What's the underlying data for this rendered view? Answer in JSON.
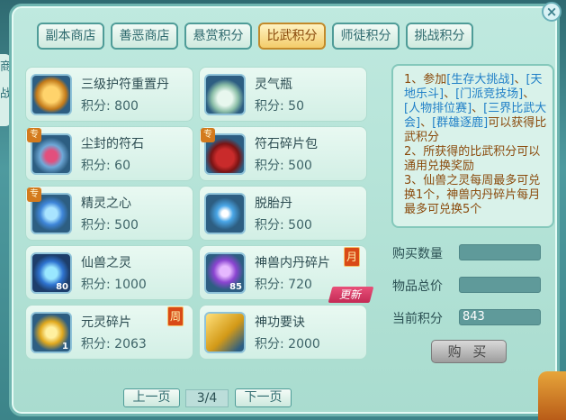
{
  "tabs": [
    {
      "label": "副本商店"
    },
    {
      "label": "善恶商店"
    },
    {
      "label": "悬赏积分"
    },
    {
      "label": "比武积分",
      "active": true
    },
    {
      "label": "师徒积分"
    },
    {
      "label": "挑战积分"
    }
  ],
  "items": [
    {
      "name": "三级护符重置丹",
      "price": "积分: 800",
      "icon": "golden-amulet-icon"
    },
    {
      "name": "灵气瓶",
      "price": "积分: 50",
      "icon": "spirit-bottle-icon"
    },
    {
      "name": "尘封的符石",
      "price": "积分: 60",
      "icon": "rune-stone-icon",
      "tag": "专"
    },
    {
      "name": "符石碎片包",
      "price": "积分: 500",
      "icon": "red-pouch-icon",
      "tag": "专"
    },
    {
      "name": "精灵之心",
      "price": "积分: 500",
      "icon": "spirit-heart-icon",
      "tag": "专"
    },
    {
      "name": "脱胎丹",
      "price": "积分: 500",
      "icon": "blue-pill-icon"
    },
    {
      "name": "仙兽之灵",
      "price": "积分: 1000",
      "icon": "beast-spirit-orb-icon",
      "count": "80"
    },
    {
      "name": "神兽内丹碎片",
      "price": "积分: 720",
      "icon": "purple-crystal-icon",
      "count": "85",
      "badge": "月",
      "ribbon": "更新"
    },
    {
      "name": "元灵碎片",
      "price": "积分: 2063",
      "icon": "gold-shard-icon",
      "count": "1",
      "badge": "周"
    },
    {
      "name": "神功要诀",
      "price": "积分: 2000",
      "icon": "gold-book-icon"
    }
  ],
  "info": {
    "line1_prefix": "1、参加",
    "line1_links": [
      "[生存大挑战]",
      "[天地乐斗]",
      "[门派竞技场]",
      "[人物排位赛]",
      "[三界比武大会]",
      "[群雄逐鹿]"
    ],
    "line1_suffix": "可以获得比武积分",
    "line2": "2、所获得的比武积分可以通用兑换奖励",
    "line3": "3、仙兽之灵每周最多可兑换1个，神兽内丹碎片每月最多可兑换5个"
  },
  "purchase": {
    "qty_label": "购买数量",
    "qty_value": "",
    "total_label": "物品总价",
    "total_value": "",
    "current_label": "当前积分",
    "current_value": "843",
    "buy_label": "购 买"
  },
  "pager": {
    "prev_label": "上一页",
    "page": "3/4",
    "next_label": "下一页"
  },
  "left_edge_text": "商 战"
}
